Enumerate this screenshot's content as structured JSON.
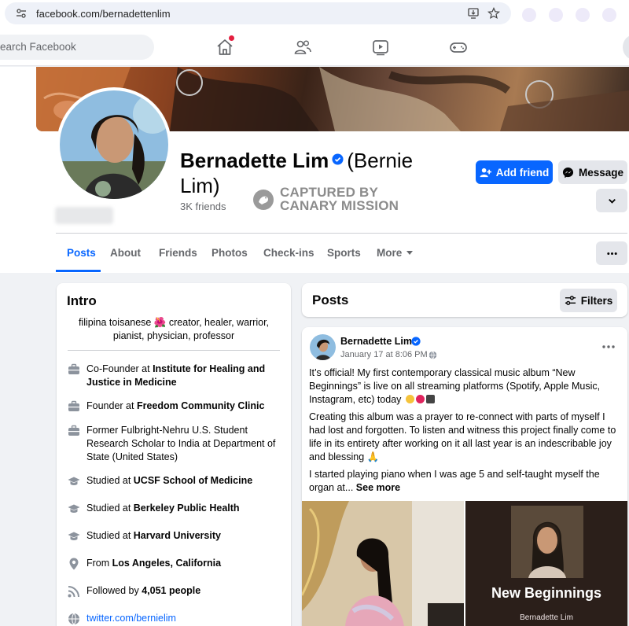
{
  "browser": {
    "url": "facebook.com/bernadettenlim"
  },
  "nav": {
    "search_placeholder": "Search Facebook",
    "search_visible_text": "earch Facebook",
    "icons": [
      "home-icon",
      "friends-icon",
      "watch-icon",
      "gaming-icon"
    ]
  },
  "profile": {
    "name": "Bernadette Lim",
    "alt_name_line1": "(Bernie",
    "alt_name_line2": "Lim)",
    "friends_count": "3K friends",
    "watermark_line1": "CAPTURED BY",
    "watermark_line2": "CANARY MISSION",
    "buttons": {
      "add_friend": "Add friend",
      "message": "Message"
    },
    "tabs": [
      "Posts",
      "About",
      "Friends",
      "Photos",
      "Check-ins",
      "Sports",
      "More"
    ],
    "active_tab": "Posts"
  },
  "intro": {
    "title": "Intro",
    "bio": "filipina toisanese 🌺 creator, healer, warrior, pianist, physician, professor",
    "items": [
      {
        "icon": "work-icon",
        "prefix": "Co-Founder at ",
        "bold": "Institute for Healing and Justice in Medicine"
      },
      {
        "icon": "work-icon",
        "prefix": "Founder at ",
        "bold": "Freedom Community Clinic"
      },
      {
        "icon": "work-icon",
        "prefix": "Former Fulbright-Nehru U.S. Student Research Scholar to India at Department of State (United States)",
        "bold": ""
      },
      {
        "icon": "education-icon",
        "prefix": "Studied at ",
        "bold": "UCSF School of Medicine"
      },
      {
        "icon": "education-icon",
        "prefix": "Studied at ",
        "bold": "Berkeley Public Health"
      },
      {
        "icon": "education-icon",
        "prefix": "Studied at ",
        "bold": "Harvard University"
      },
      {
        "icon": "location-icon",
        "prefix": "From ",
        "bold": "Los Angeles, California"
      },
      {
        "icon": "followers-icon",
        "prefix": "Followed by ",
        "bold": "4,051 people"
      },
      {
        "icon": "globe-icon",
        "link": "twitter.com/bernielim"
      }
    ]
  },
  "posts": {
    "title": "Posts",
    "filters_label": "Filters",
    "post": {
      "author": "Bernadette Lim",
      "date": "January 17 at 8:06 PM ·",
      "paragraph1": "It’s official! My first contemporary classical music album “New Beginnings” is live on all streaming platforms (Spotify, Apple Music, Instagram, etc) today",
      "paragraph2": "Creating this album was a prayer to re-connect with parts of myself I had lost and forgotten. To listen and witness this project finally come to life in its entirety after working on it all last year is an indescribable joy and blessing 🙏",
      "paragraph3": "I started playing piano when I was age 5 and self-taught myself the organ at...",
      "see_more": "See more",
      "album_title": "New Beginnings",
      "album_artist": "Bernadette Lim"
    }
  }
}
